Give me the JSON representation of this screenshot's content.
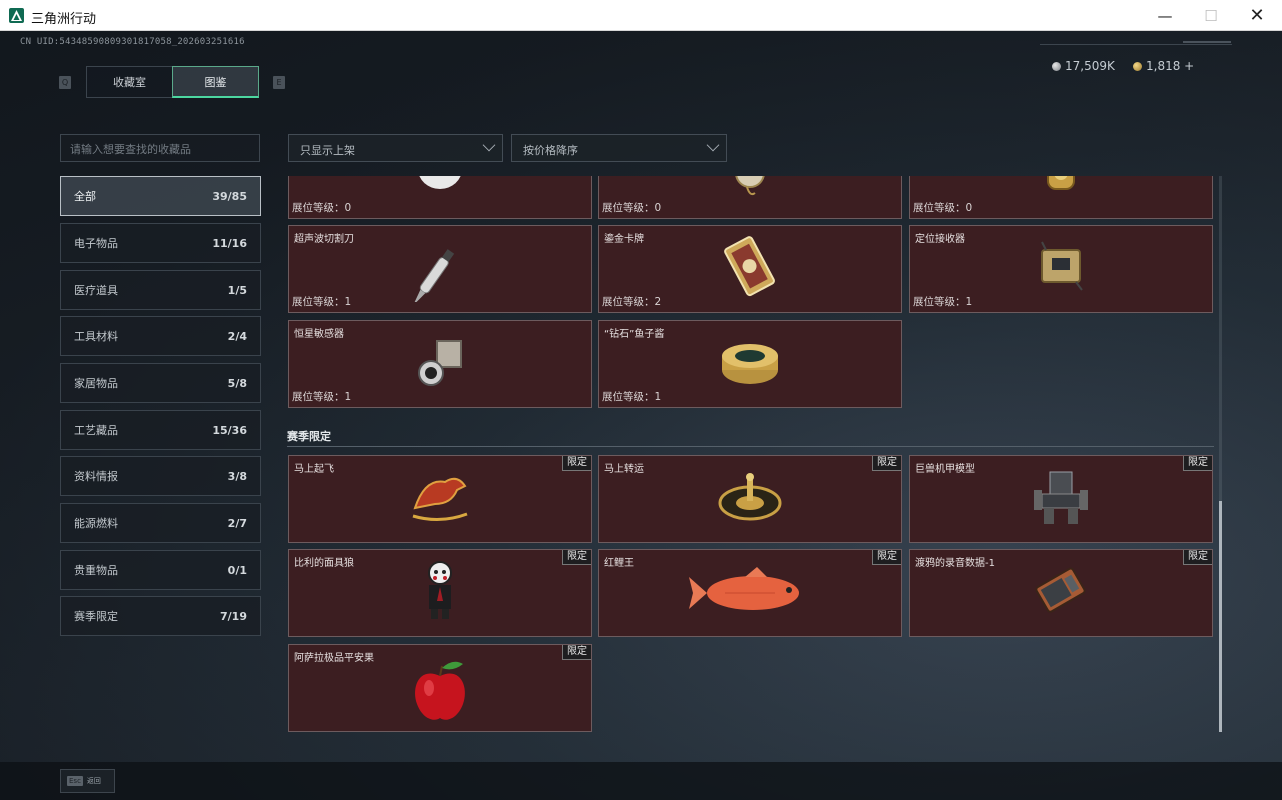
{
  "window": {
    "title": "三角洲行动",
    "min": "—",
    "max": "☐",
    "close": "✕"
  },
  "header": {
    "uid": "CN UID:54348590809301817058_202603251616",
    "key_left": "Q",
    "key_right": "E",
    "tabs": [
      {
        "label": "收藏室"
      },
      {
        "label": "图鉴"
      }
    ],
    "currency": [
      {
        "value": "17,509K"
      },
      {
        "value": "1,818 +"
      }
    ]
  },
  "search": {
    "placeholder": "请输入想要查找的收藏品"
  },
  "filters": [
    {
      "value": "只显示上架"
    },
    {
      "value": "按价格降序"
    }
  ],
  "categories": [
    {
      "label": "全部",
      "count": "39/85"
    },
    {
      "label": "电子物品",
      "count": "11/16"
    },
    {
      "label": "医疗道具",
      "count": "1/5"
    },
    {
      "label": "工具材料",
      "count": "2/4"
    },
    {
      "label": "家居物品",
      "count": "5/8"
    },
    {
      "label": "工艺藏品",
      "count": "15/36"
    },
    {
      "label": "资料情报",
      "count": "3/8"
    },
    {
      "label": "能源燃料",
      "count": "2/7"
    },
    {
      "label": "贵重物品",
      "count": "0/1"
    },
    {
      "label": "赛季限定",
      "count": "7/19"
    }
  ],
  "cards_top": [
    {
      "name": "",
      "level": "展位等级：0",
      "icon": "white-orb-icon"
    },
    {
      "name": "",
      "level": "展位等级：0",
      "icon": "pocket-watch-icon"
    },
    {
      "name": "",
      "level": "展位等级：0",
      "icon": "gold-watch-icon"
    },
    {
      "name": "超声波切割刀",
      "level": "展位等级：1",
      "icon": "ultrasonic-knife-icon"
    },
    {
      "name": "鎏金卡牌",
      "level": "展位等级：2",
      "icon": "gilded-card-icon"
    },
    {
      "name": "定位接收器",
      "level": "展位等级：1",
      "icon": "locator-receiver-icon"
    },
    {
      "name": "恒星敏感器",
      "level": "展位等级：1",
      "icon": "star-sensor-icon"
    },
    {
      "name": "“钻石”鱼子酱",
      "level": "展位等级：1",
      "icon": "caviar-tin-icon"
    }
  ],
  "section": {
    "title": "赛季限定"
  },
  "cards_season": [
    {
      "name": "马上起飞",
      "tag": "限定",
      "icon": "golden-horse-icon"
    },
    {
      "name": "马上转运",
      "tag": "限定",
      "icon": "fortune-wheel-icon"
    },
    {
      "name": "巨兽机甲模型",
      "tag": "限定",
      "icon": "mech-model-icon"
    },
    {
      "name": "比利的面具狼",
      "tag": "限定",
      "icon": "billy-puppet-icon"
    },
    {
      "name": "红鲤王",
      "tag": "限定",
      "icon": "red-carp-icon"
    },
    {
      "name": "渡鸦的录音数据-1",
      "tag": "限定",
      "icon": "recorder-icon"
    },
    {
      "name": "阿萨拉极品平安果",
      "tag": "限定",
      "icon": "red-apple-icon"
    }
  ],
  "footer": {
    "key": "Esc",
    "label": "返回"
  }
}
